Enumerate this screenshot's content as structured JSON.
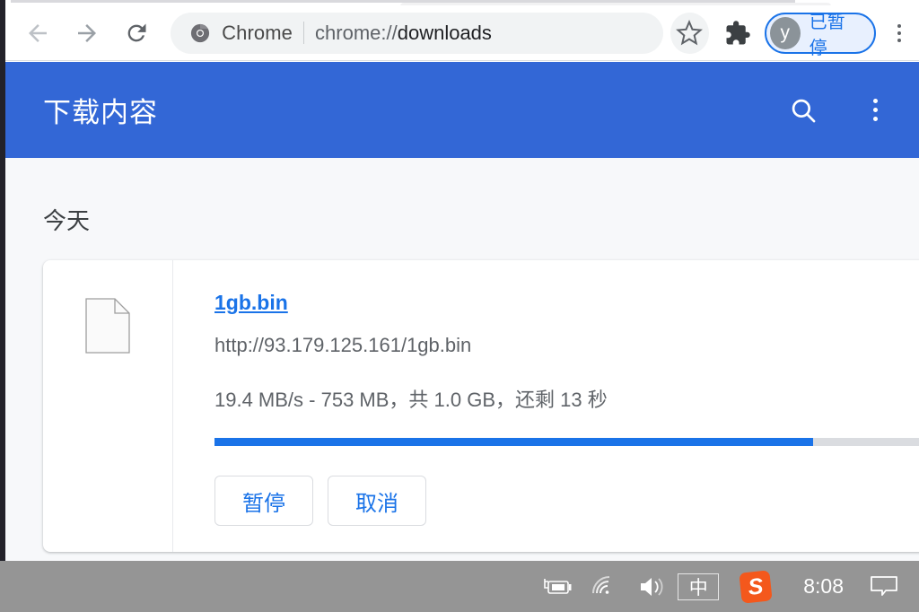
{
  "browser": {
    "nav": {
      "back_icon": "arrow-left-icon",
      "forward_icon": "arrow-right-icon",
      "reload_icon": "reload-icon"
    },
    "omnibox": {
      "brand_label": "Chrome",
      "url_prefix": "chrome://",
      "url_suffix": "downloads",
      "full_url": "chrome://downloads",
      "chrome_icon": "chrome-logo-icon",
      "star_icon": "bookmark-star-icon"
    },
    "extensions_icon": "puzzle-piece-icon",
    "profile": {
      "avatar_initial": "y",
      "status_label": "已暂停",
      "accent_color": "#1a73e8",
      "background_color": "#e8f0fe"
    },
    "menu_icon": "three-dots-vertical-icon"
  },
  "page": {
    "title": "下载内容",
    "header_color": "#3367d6",
    "search_icon": "search-icon",
    "overflow_icon": "three-dots-vertical-icon",
    "date_heading": "今天"
  },
  "download": {
    "file_icon": "generic-file-icon",
    "file_name": "1gb.bin",
    "source_url": "http://93.179.125.161/1gb.bin",
    "status_text": "19.4 MB/s - 753 MB，共 1.0 GB，还剩 13 秒",
    "speed": "19.4 MB/s",
    "received": "753 MB",
    "total_size": "1.0 GB",
    "time_remaining": "13 秒",
    "progress_percent": 84,
    "progress_fill_color": "#1a73e8",
    "progress_track_color": "#dadce0",
    "pause_label": "暂停",
    "cancel_label": "取消"
  },
  "taskbar": {
    "battery_icon": "battery-charging-icon",
    "wifi_icon": "wifi-icon",
    "volume_icon": "volume-icon",
    "ime_label": "中",
    "sogou_label": "S",
    "sogou_color": "#f4581c",
    "clock": "8:08",
    "notification_icon": "speech-bubble-icon",
    "background_color": "#959595"
  }
}
